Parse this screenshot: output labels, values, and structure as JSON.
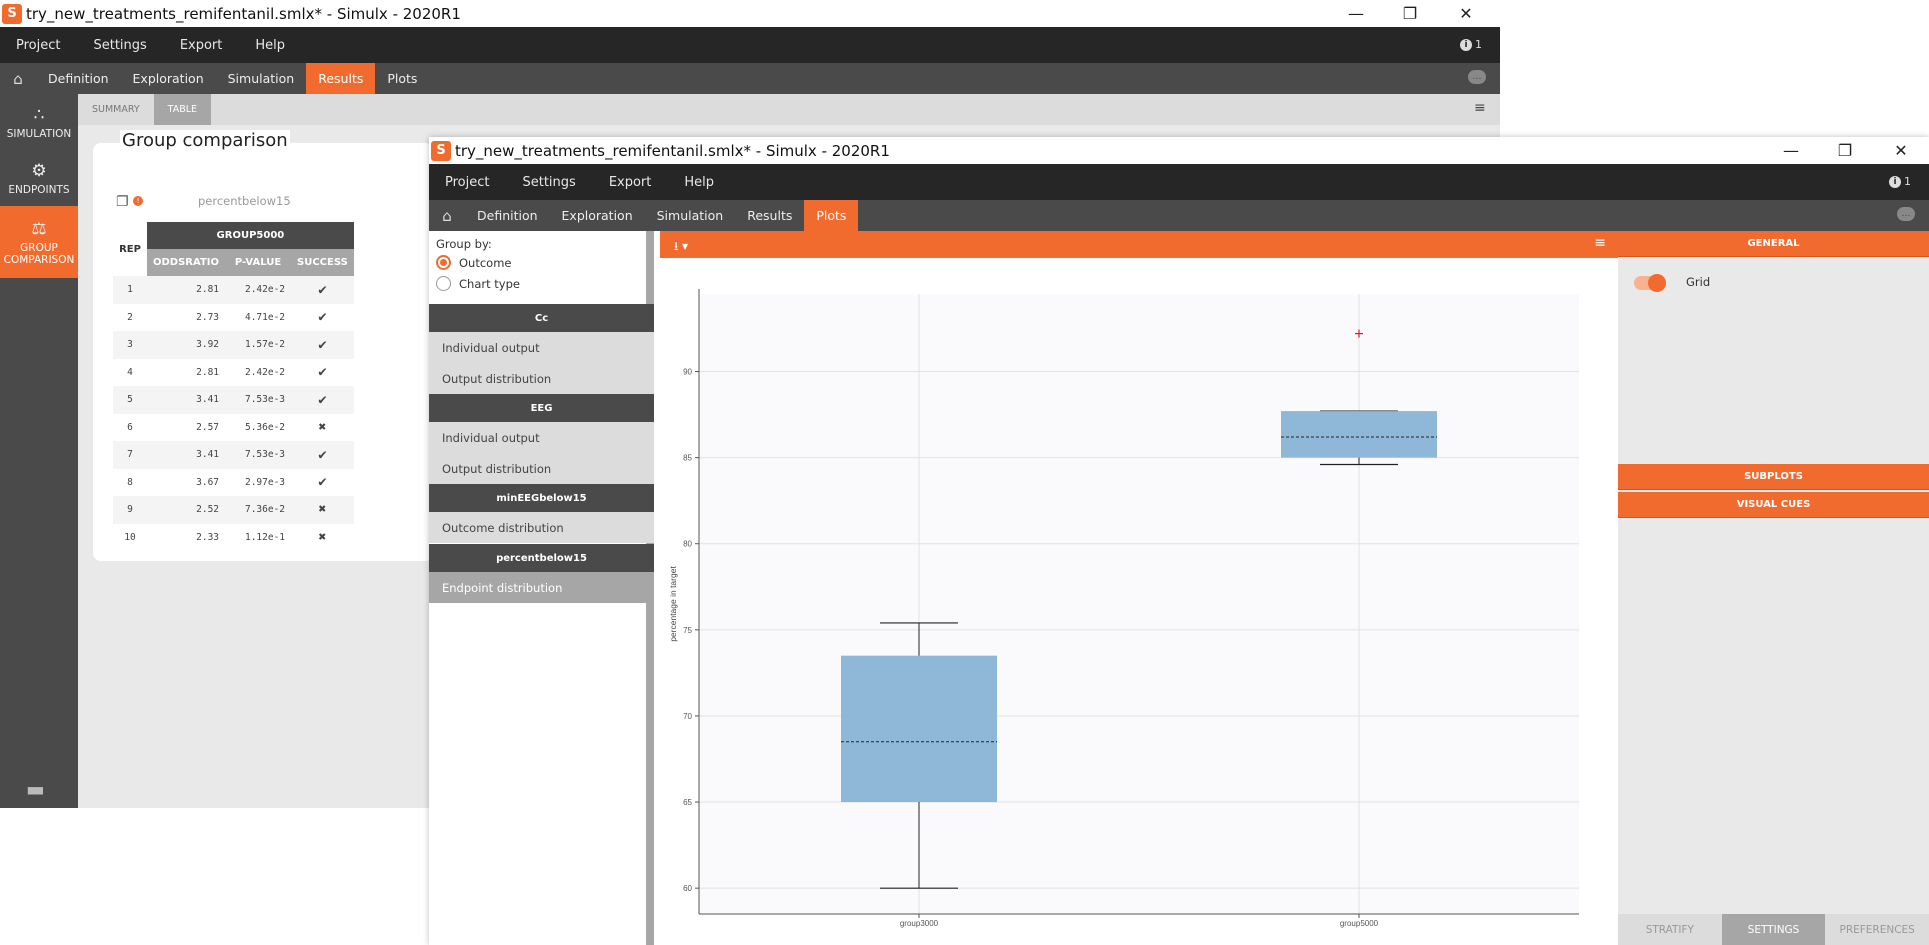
{
  "back_window": {
    "title": "try_new_treatments_remifentanil.smlx* - Simulx - 2020R1",
    "menu": [
      "Project",
      "Settings",
      "Export",
      "Help"
    ],
    "info_count": "1",
    "tabs": [
      "Definition",
      "Exploration",
      "Simulation",
      "Results",
      "Plots"
    ],
    "active_tab": "Results",
    "sidebar": [
      {
        "label": "SIMULATION",
        "icon": "simulation-icon"
      },
      {
        "label": "ENDPOINTS",
        "icon": "endpoints-icon"
      },
      {
        "label": "GROUP COMPARISON",
        "icon": "group-comparison-icon"
      }
    ],
    "subtabs": [
      "SUMMARY",
      "TABLE"
    ],
    "active_subtab": "TABLE",
    "panel_title": "Group comparison",
    "table_caption": "percentbelow15",
    "table": {
      "rep_header": "REP",
      "group_header": "GROUP5000",
      "columns": [
        "ODDSRATIO",
        "P-VALUE",
        "SUCCESS"
      ],
      "rows": [
        {
          "rep": "1",
          "oddsratio": "2.81",
          "pvalue": "2.42e-2",
          "success": true
        },
        {
          "rep": "2",
          "oddsratio": "2.73",
          "pvalue": "4.71e-2",
          "success": true
        },
        {
          "rep": "3",
          "oddsratio": "3.92",
          "pvalue": "1.57e-2",
          "success": true
        },
        {
          "rep": "4",
          "oddsratio": "2.81",
          "pvalue": "2.42e-2",
          "success": true
        },
        {
          "rep": "5",
          "oddsratio": "3.41",
          "pvalue": "7.53e-3",
          "success": true
        },
        {
          "rep": "6",
          "oddsratio": "2.57",
          "pvalue": "5.36e-2",
          "success": false
        },
        {
          "rep": "7",
          "oddsratio": "3.41",
          "pvalue": "7.53e-3",
          "success": true
        },
        {
          "rep": "8",
          "oddsratio": "3.67",
          "pvalue": "2.97e-3",
          "success": true
        },
        {
          "rep": "9",
          "oddsratio": "2.52",
          "pvalue": "7.36e-2",
          "success": false
        },
        {
          "rep": "10",
          "oddsratio": "2.33",
          "pvalue": "1.12e-1",
          "success": false
        }
      ]
    }
  },
  "front_window": {
    "title": "try_new_treatments_remifentanil.smlx* - Simulx - 2020R1",
    "menu": [
      "Project",
      "Settings",
      "Export",
      "Help"
    ],
    "info_count": "1",
    "tabs": [
      "Definition",
      "Exploration",
      "Simulation",
      "Results",
      "Plots"
    ],
    "active_tab": "Plots",
    "group_by": {
      "label": "Group by:",
      "options": [
        "Outcome",
        "Chart type"
      ],
      "selected": "Outcome"
    },
    "sections": [
      {
        "header": "Cc",
        "items": [
          "Individual output",
          "Output distribution"
        ]
      },
      {
        "header": "EEG",
        "items": [
          "Individual output",
          "Output distribution"
        ]
      },
      {
        "header": "minEEGbelow15",
        "items": [
          "Outcome distribution"
        ]
      },
      {
        "header": "percentbelow15",
        "items": [
          "Endpoint distribution"
        ]
      }
    ],
    "selected_item": "Endpoint distribution",
    "settings": {
      "sections": [
        "GENERAL",
        "SUBPLOTS",
        "VISUAL CUES"
      ],
      "grid_label": "Grid",
      "grid_on": true,
      "bottom_tabs": [
        "STRATIFY",
        "SETTINGS",
        "PREFERENCES"
      ],
      "active_bottom_tab": "SETTINGS"
    }
  },
  "chart_data": {
    "type": "box",
    "ylabel": "percentage in target",
    "ylim": [
      58.5,
      94.5
    ],
    "yticks": [
      60,
      65,
      70,
      75,
      80,
      85,
      90
    ],
    "grid": true,
    "box_color": "#8fb8d8",
    "outlier_color": "#e41a1c",
    "categories": [
      "group3000",
      "group5000"
    ],
    "boxes": [
      {
        "name": "group3000",
        "min": 60.0,
        "q1": 65.0,
        "median": 68.5,
        "q3": 73.5,
        "max": 75.4,
        "outliers": []
      },
      {
        "name": "group5000",
        "min": 84.6,
        "q1": 85.0,
        "median": 86.2,
        "q3": 87.7,
        "max": 87.7,
        "outliers": [
          92.2
        ]
      }
    ]
  }
}
